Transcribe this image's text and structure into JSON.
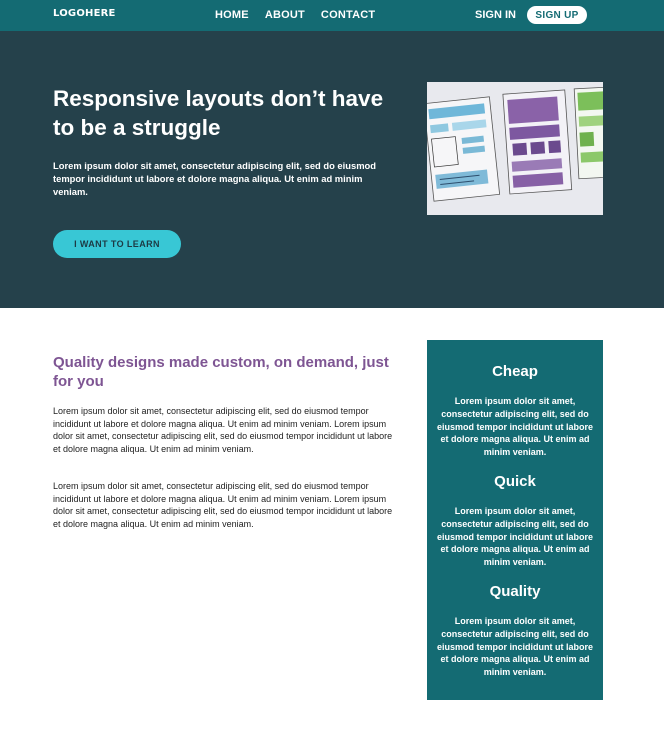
{
  "nav": {
    "logo": "LOGOHERE",
    "links": [
      "HOME",
      "ABOUT",
      "CONTACT"
    ],
    "sign_in": "SIGN IN",
    "sign_up": "SIGN UP"
  },
  "hero": {
    "title": "Responsive layouts don’t have to be a struggle",
    "text": "Lorem ipsum dolor sit amet, consectetur adipiscing elit, sed do eiusmod tempor incididunt ut labore et dolore magna aliqua. Ut enim ad minim veniam.",
    "cta": "I WANT TO LEARN"
  },
  "main": {
    "title": "Quality designs made custom, on demand, just for you",
    "paragraphs": [
      "Lorem ipsum dolor sit amet, consectetur adipiscing elit, sed do eiusmod tempor incididunt ut labore et dolore magna aliqua. Ut enim ad minim veniam. Lorem ipsum dolor sit amet, consectetur adipiscing elit, sed do eiusmod tempor incididunt ut labore et dolore magna aliqua. Ut enim ad minim veniam.",
      "Lorem ipsum dolor sit amet, consectetur adipiscing elit, sed do eiusmod tempor incididunt ut labore et dolore magna aliqua. Ut enim ad minim veniam. Lorem ipsum dolor sit amet, consectetur adipiscing elit, sed do eiusmod tempor incididunt ut labore et dolore magna aliqua. Ut enim ad minim veniam."
    ]
  },
  "sidebar": {
    "features": [
      {
        "title": "Cheap",
        "text": "Lorem ipsum dolor sit amet, consectetur adipiscing elit, sed do eiusmod tempor incididunt ut labore et dolore magna aliqua. Ut enim ad minim veniam."
      },
      {
        "title": "Quick",
        "text": "Lorem ipsum dolor sit amet, consectetur adipiscing elit, sed do eiusmod tempor incididunt ut labore et dolore magna aliqua. Ut enim ad minim veniam."
      },
      {
        "title": "Quality",
        "text": "Lorem ipsum dolor sit amet, consectetur adipiscing elit, sed do eiusmod tempor incididunt ut labore et dolore magna aliqua. Ut enim ad minim veniam."
      }
    ]
  },
  "colors": {
    "nav_bg": "#146b73",
    "hero_bg": "#25414b",
    "accent_cta": "#38c7d5",
    "heading_purple": "#7e5593"
  }
}
